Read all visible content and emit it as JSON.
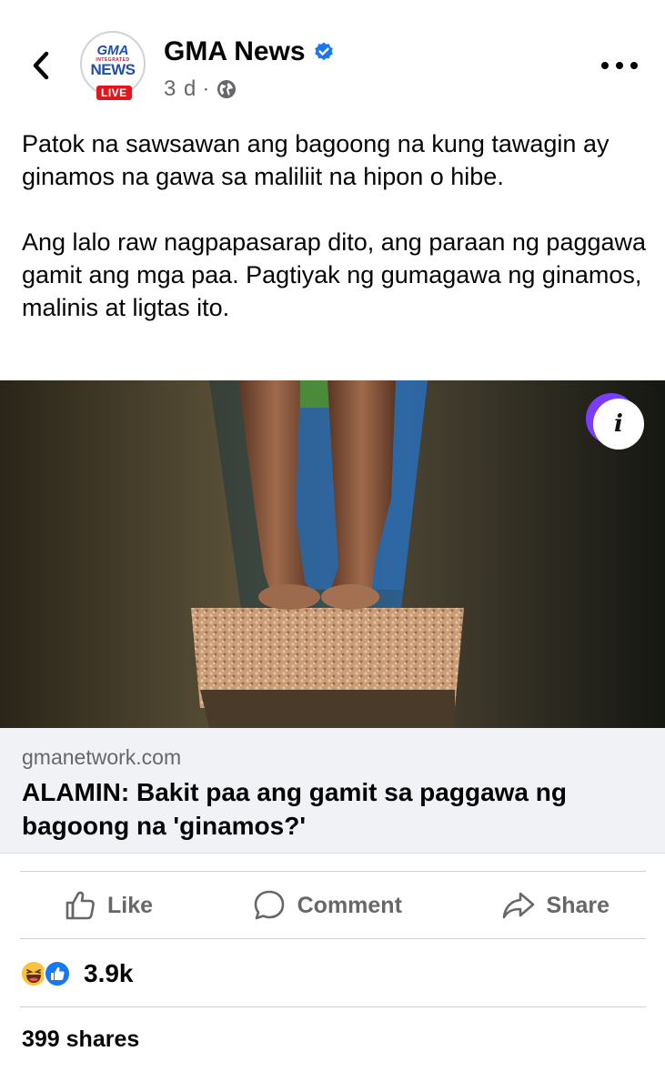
{
  "post": {
    "page_name": "GMA News",
    "verified_icon": "verified-badge-icon",
    "time": "3 d",
    "separator": "·",
    "privacy_icon": "globe-icon",
    "avatar": {
      "line1": "GMA",
      "line2": "INTEGRATED",
      "line3": "NEWS",
      "badge": "LIVE"
    },
    "caption": [
      "Patok na sawsawan ang bagoong na kung tawagin ay ginamos na gawa sa maliliit na hipon o hibe.",
      "Ang lalo raw nagpapasarap dito, ang paraan ng paggawa gamit ang mga paa. Pagtiyak ng gumagawa ng ginamos, malinis at ligtas ito."
    ]
  },
  "link": {
    "domain": "gmanetwork.com",
    "headline": "ALAMIN: Bakit paa ang gamit sa paggawa ng bagoong na 'ginamos?'",
    "info_label": "i"
  },
  "actions": {
    "like": "Like",
    "comment": "Comment",
    "share": "Share"
  },
  "stats": {
    "reaction_count": "3.9k",
    "reaction_icons": [
      "haha-icon",
      "like-reaction-icon"
    ],
    "shares": "399 shares"
  },
  "colors": {
    "accent": "#1877f2",
    "muted": "#65676b",
    "live_red": "#e1171e",
    "card_bg": "#f0f2f5"
  }
}
